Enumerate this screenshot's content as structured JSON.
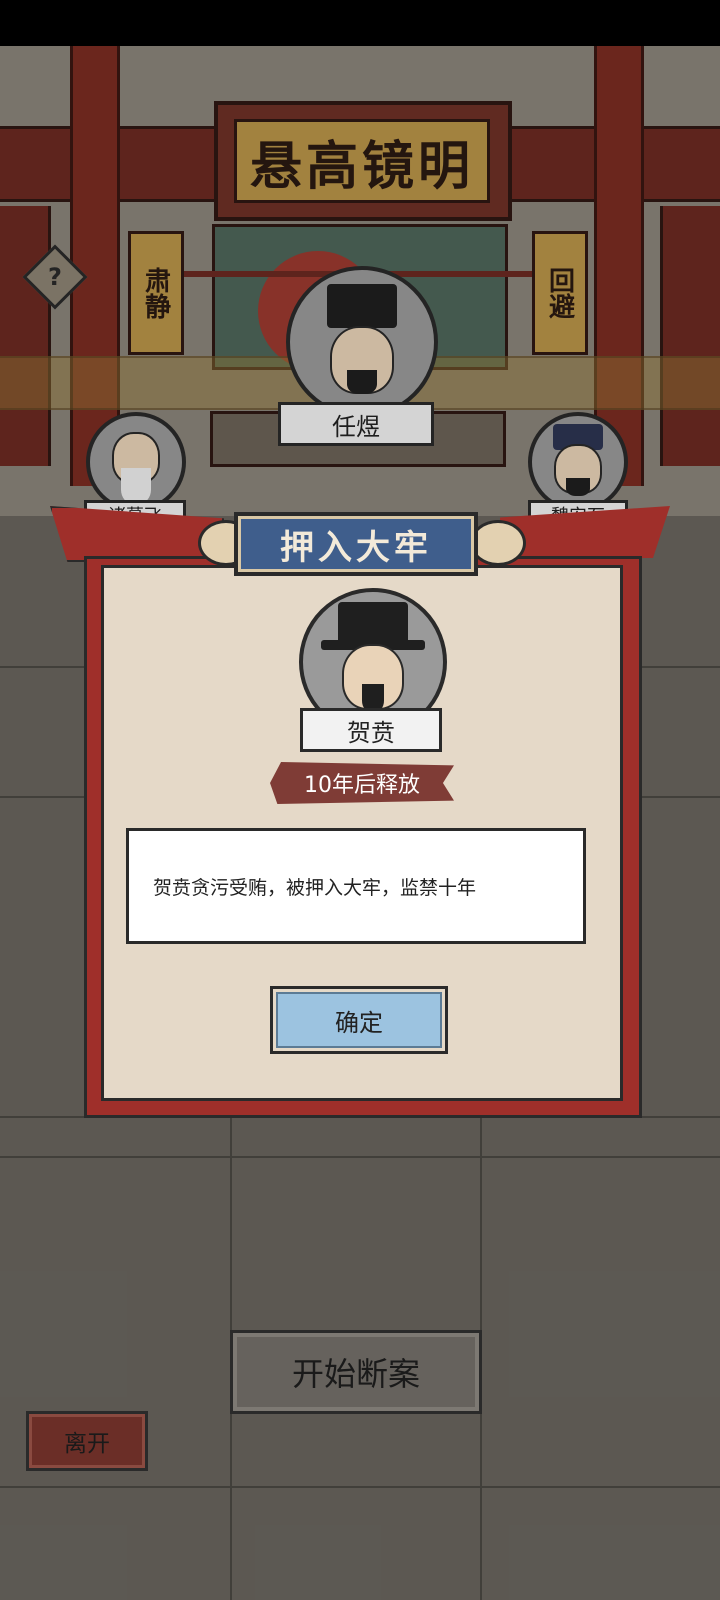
{
  "hall": {
    "plaque_text": "悬高镜明",
    "left_sign": "肃静",
    "right_sign": "回避"
  },
  "judge": {
    "name": "任煜"
  },
  "advisors": [
    {
      "name": "诸葛飞"
    },
    {
      "name": "魏安石"
    }
  ],
  "dialog": {
    "title": "押入大牢",
    "defendant_name": "贺贲",
    "verdict_badge": "10年后释放",
    "description": "贺贲贪污受贿，被押入大牢，监禁十年",
    "confirm_label": "确定"
  },
  "controls": {
    "start_label": "开始断案",
    "leave_label": "离开",
    "help_icon": "question-diamond-icon",
    "help_symbol": "?"
  }
}
